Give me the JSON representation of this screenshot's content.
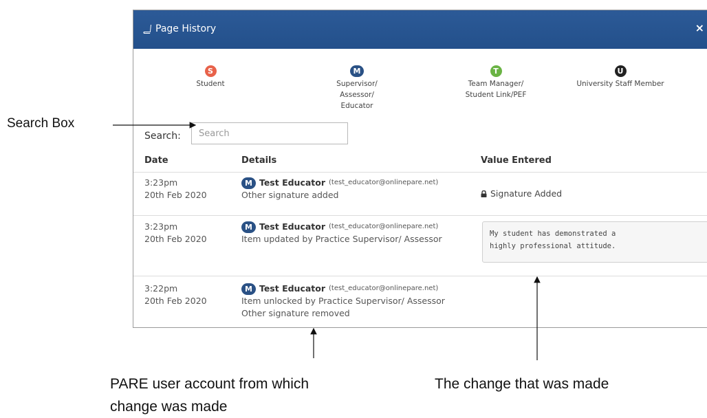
{
  "modal": {
    "title": "Page History",
    "close": "×",
    "header_color": "#275491"
  },
  "legend": [
    {
      "letter": "S",
      "label_lines": [
        "Student"
      ],
      "color": "#e8624a"
    },
    {
      "letter": "M",
      "label_lines": [
        "Supervisor/",
        "Assessor/",
        "Educator"
      ],
      "color": "#2a5185"
    },
    {
      "letter": "T",
      "label_lines": [
        "Team Manager/",
        "Student Link/PEF"
      ],
      "color": "#6ab344"
    },
    {
      "letter": "U",
      "label_lines": [
        "University Staff Member"
      ],
      "color": "#222222"
    }
  ],
  "search": {
    "label": "Search:",
    "placeholder": "Search"
  },
  "table": {
    "headers": {
      "date": "Date",
      "details": "Details",
      "value": "Value Entered"
    },
    "rows": [
      {
        "time": "3:23pm",
        "date": "20th Feb 2020",
        "badge": "M",
        "user": "Test Educator",
        "email": "(test_educator@onlinepare.net)",
        "details": [
          "Other signature added"
        ],
        "value": "Signature Added"
      },
      {
        "time": "3:23pm",
        "date": "20th Feb 2020",
        "badge": "M",
        "user": "Test Educator",
        "email": "(test_educator@onlinepare.net)",
        "details": [
          "Item updated by Practice Supervisor/ Assessor"
        ],
        "value_box": "My student has demonstrated a\nhighly professional attitude."
      },
      {
        "time": "3:22pm",
        "date": "20th Feb 2020",
        "badge": "M",
        "user": "Test Educator",
        "email": "(test_educator@onlinepare.net)",
        "details": [
          "Item unlocked by Practice Supervisor/ Assessor",
          "Other signature removed"
        ]
      }
    ]
  },
  "annotations": {
    "search_box": "Search Box",
    "user_account_line1": "PARE user account from which",
    "user_account_line2": "change was made",
    "change_made": "The change that was made"
  },
  "icons": {
    "title": "book-icon",
    "lock": "lock-icon",
    "close": "close-icon"
  }
}
